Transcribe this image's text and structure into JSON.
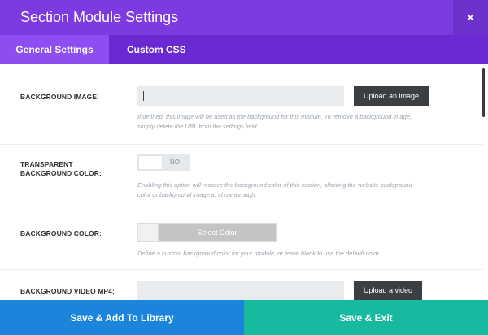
{
  "modal": {
    "title": "Section Module Settings",
    "close_icon": "close-icon",
    "close_glyph": "×"
  },
  "tabs": [
    {
      "label": "General Settings",
      "active": true
    },
    {
      "label": "Custom CSS",
      "active": false
    }
  ],
  "settings": {
    "background_image": {
      "label": "BACKGROUND IMAGE:",
      "value": "",
      "button": "Upload an image",
      "help": "If defined, this image will be used as the background for this module. To remove a background image, simply delete the URL from the settings field."
    },
    "transparent_bg": {
      "label_line1": "TRANSPARENT",
      "label_line2": "BACKGROUND COLOR:",
      "toggle_value": "NO",
      "help": "Enabling this option will remove the background color of this section, allowing the website background color or background image to show through."
    },
    "background_color": {
      "label": "BACKGROUND COLOR:",
      "button": "Select Color",
      "help": "Define a custom background color for your module, or leave blank to use the default color."
    },
    "background_video_mp4": {
      "label": "BACKGROUND VIDEO MP4:",
      "value": "",
      "button": "Upload a video"
    }
  },
  "footer": {
    "save_library": "Save & Add To Library",
    "save_exit": "Save & Exit"
  },
  "colors": {
    "title_bar": "#7c3ae0",
    "tab_bar": "#6a29d2",
    "active_tab": "#8e4df0",
    "save_library": "#1b85dc",
    "save_exit": "#19b9a0"
  }
}
